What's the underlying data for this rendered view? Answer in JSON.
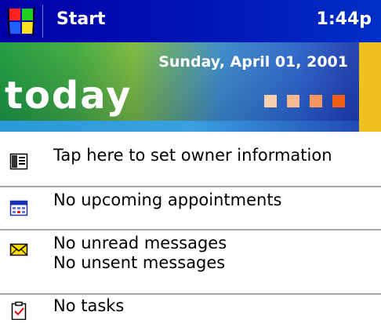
{
  "titlebar": {
    "title": "Start",
    "time": "1:44p"
  },
  "banner": {
    "date": "Sunday, April 01, 2001",
    "heading": "today",
    "square_colors": [
      "#f8d0b0",
      "#f8b890",
      "#f89860",
      "#f06018"
    ]
  },
  "items": [
    {
      "icon": "owner-card-icon",
      "lines": [
        "Tap here to set owner information"
      ]
    },
    {
      "icon": "calendar-icon",
      "lines": [
        "No upcoming appointments"
      ]
    },
    {
      "icon": "envelope-icon",
      "lines": [
        "No unread messages",
        "No unsent messages"
      ]
    },
    {
      "icon": "tasks-clipboard-icon",
      "lines": [
        "No tasks"
      ]
    }
  ]
}
